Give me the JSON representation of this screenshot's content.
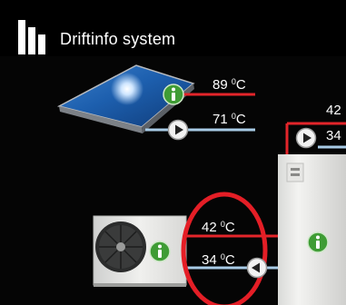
{
  "header": {
    "title": "Driftinfo system",
    "logo_icon": "bar-chart-logo-icon"
  },
  "solar_panel": {
    "supply_temp": {
      "value": "89",
      "unit": "C",
      "degree": "0"
    },
    "return_temp": {
      "value": "71",
      "unit": "C",
      "degree": "0"
    }
  },
  "heat_pump": {
    "supply_temp": {
      "value": "42",
      "unit": "C",
      "degree": "0"
    },
    "return_temp": {
      "value": "34",
      "unit": "C",
      "degree": "0"
    }
  },
  "indoor_unit": {
    "supply_temp_partial": "42",
    "return_temp_partial": "34"
  },
  "colors": {
    "hot_pipe": "#e3252a",
    "cold_pipe": "#a8cbe6",
    "info_green": "#3f9c35",
    "highlight_ring": "#e41e26"
  },
  "icons": {
    "info": "info-icon",
    "pump": "pump-icon"
  }
}
